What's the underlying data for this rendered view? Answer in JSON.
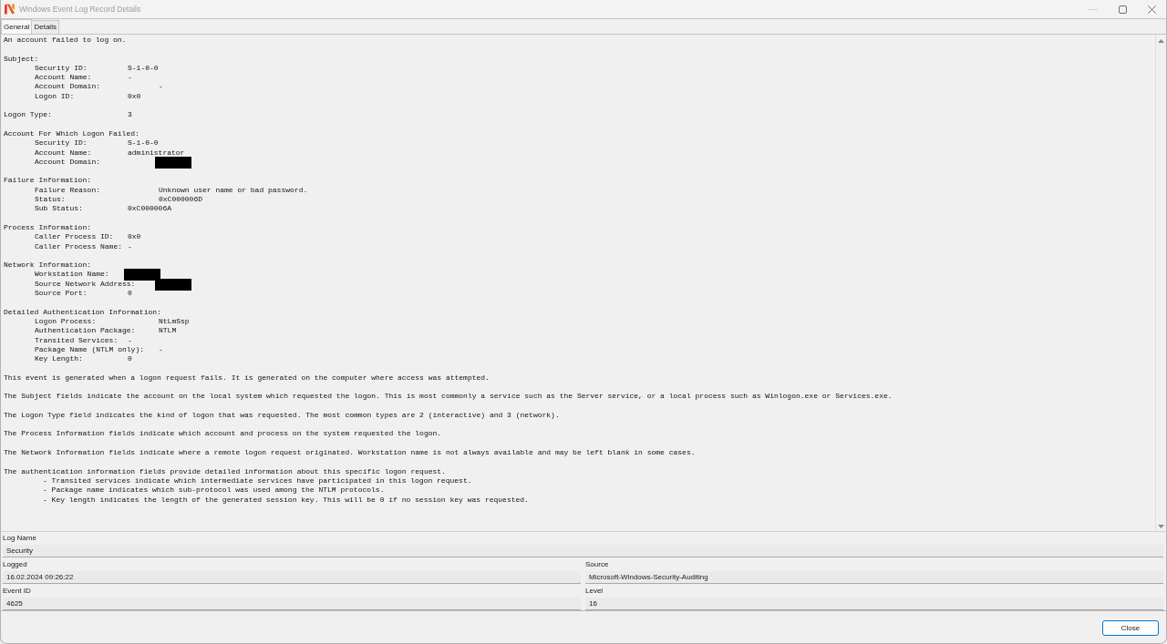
{
  "window": {
    "title": "Windows Event Log Record Details",
    "controls": [
      {
        "kind": "minimize",
        "disabled": true
      },
      {
        "kind": "maximize",
        "disabled": false
      },
      {
        "kind": "close",
        "disabled": false
      }
    ]
  },
  "tabs": [
    {
      "label": "General",
      "selected": true
    },
    {
      "label": "Details",
      "selected": false
    }
  ],
  "description": [
    {
      "kind": "line",
      "text": "An account failed to log on."
    },
    {
      "kind": "section",
      "heading": "Subject:",
      "fields": [
        {
          "text": "Security ID:\t\tS-1-0-0",
          "redacted": false
        },
        {
          "text": "Account Name:\t\t-",
          "redacted": false
        },
        {
          "text": "Account Domain:\t\t-",
          "redacted": false
        },
        {
          "text": "Logon ID:\t\t0x0",
          "redacted": false
        }
      ]
    },
    {
      "kind": "line",
      "text": "Logon Type:\t\t\t3"
    },
    {
      "kind": "section",
      "heading": "Account For Which Logon Failed:",
      "fields": [
        {
          "text": "Security ID:\t\tS-1-0-0",
          "redacted": false
        },
        {
          "text": "Account Name:\t\tadministrator",
          "redacted": false
        },
        {
          "text": "Account Domain:\t\t",
          "redacted": true
        }
      ]
    },
    {
      "kind": "section",
      "heading": "Failure Information:",
      "fields": [
        {
          "text": "Failure Reason:\t\tUnknown user name or bad password.",
          "redacted": false
        },
        {
          "text": "Status:\t\t\t0xC000006D",
          "redacted": false
        },
        {
          "text": "Sub Status:\t\t0xC000006A",
          "redacted": false
        }
      ]
    },
    {
      "kind": "section",
      "heading": "Process Information:",
      "fields": [
        {
          "text": "Caller Process ID:\t0x0",
          "redacted": false
        },
        {
          "text": "Caller Process Name:\t-",
          "redacted": false
        }
      ]
    },
    {
      "kind": "section",
      "heading": "Network Information:",
      "fields": [
        {
          "text": "Workstation Name:\t",
          "redacted": true
        },
        {
          "text": "Source Network Address:\t",
          "redacted": true
        },
        {
          "text": "Source Port:\t\t0",
          "redacted": false
        }
      ]
    },
    {
      "kind": "section",
      "heading": "Detailed Authentication Information:",
      "fields": [
        {
          "text": "Logon Process:\t\tNtLmSsp",
          "redacted": false
        },
        {
          "text": "Authentication Package:\tNTLM",
          "redacted": false
        },
        {
          "text": "Transited Services:\t-",
          "redacted": false
        },
        {
          "text": "Package Name (NTLM only):\t-",
          "redacted": false
        },
        {
          "text": "Key Length:\t\t0",
          "redacted": false
        }
      ]
    },
    {
      "kind": "line",
      "text": "This event is generated when a logon request fails. It is generated on the computer where access was attempted."
    },
    {
      "kind": "line",
      "text": "The Subject fields indicate the account on the local system which requested the logon. This is most commonly a service such as the Server service, or a local process such as Winlogon.exe or Services.exe."
    },
    {
      "kind": "line",
      "text": "The Logon Type field indicates the kind of logon that was requested. The most common types are 2 (interactive) and 3 (network)."
    },
    {
      "kind": "line",
      "text": "The Process Information fields indicate which account and process on the system requested the logon."
    },
    {
      "kind": "line",
      "text": "The Network Information fields indicate where a remote logon request originated. Workstation name is not always available and may be left blank in some cases."
    },
    {
      "kind": "list",
      "text": "The authentication information fields provide detailed information about this specific logon request.",
      "items": [
        "- Transited services indicate which intermediate services have participated in this logon request.",
        "- Package name indicates which sub-protocol was used among the NTLM protocols.",
        "- Key length indicates the length of the generated session key. This will be 0 if no session key was requested."
      ]
    }
  ],
  "log_name": {
    "label": "Log Name",
    "value": "Security"
  },
  "fields": [
    {
      "label": "Logged",
      "value": "16.02.2024 09:26:22"
    },
    {
      "label": "Source",
      "value": "Microsoft-Windows-Security-Auditing"
    },
    {
      "label": "Event ID",
      "value": "4625"
    },
    {
      "label": "Level",
      "value": "16"
    }
  ],
  "buttons": [
    {
      "label": "Close",
      "default": true
    }
  ]
}
